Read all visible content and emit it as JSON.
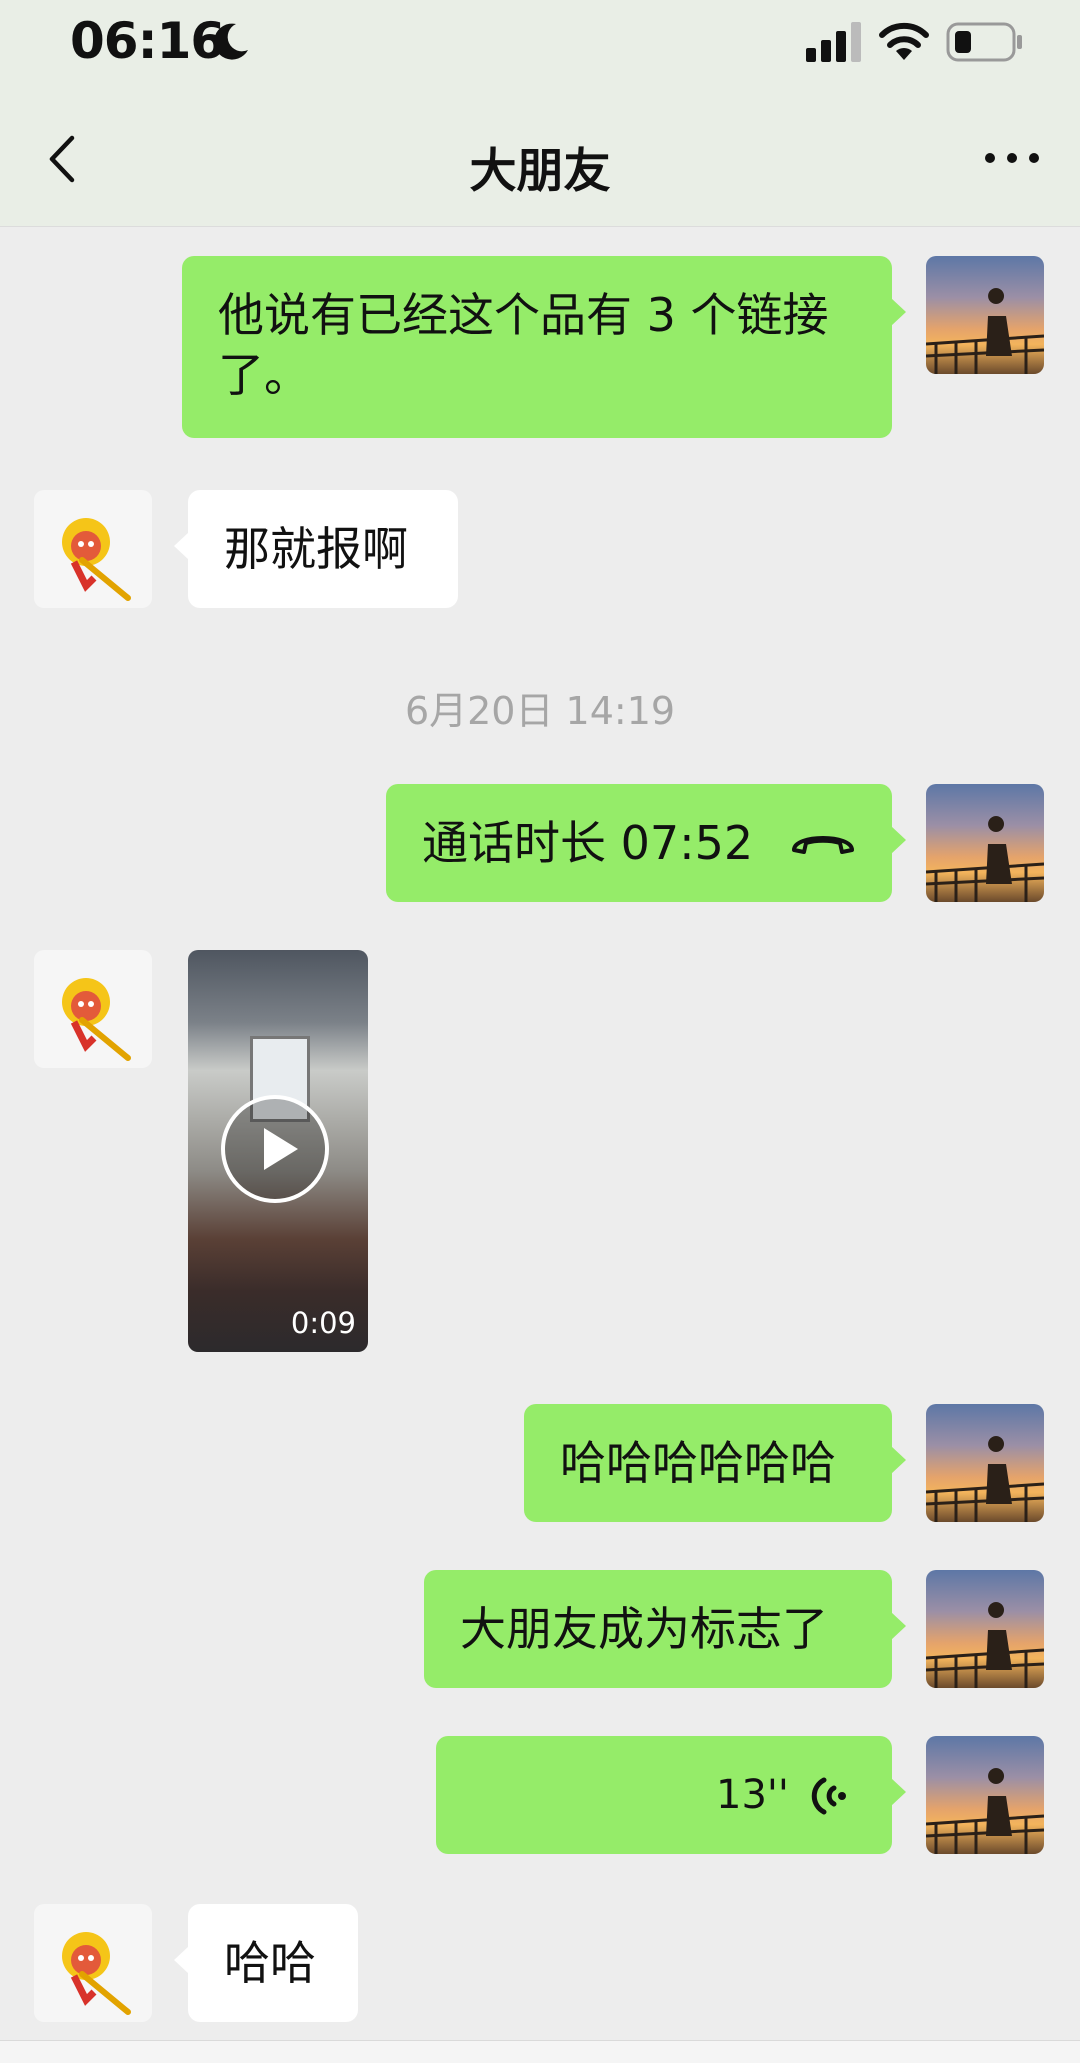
{
  "status_bar": {
    "time": "06:16"
  },
  "nav": {
    "title": "大朋友"
  },
  "messages": [
    {
      "text": "他说有已经这个品有 3 个链接了。"
    },
    {
      "text": "那就报啊"
    },
    {
      "text": "通话时长 07:52"
    },
    {
      "duration": "0:09"
    },
    {
      "text": "哈哈哈哈哈哈"
    },
    {
      "text": "大朋友成为标志了"
    },
    {
      "text": "13''"
    },
    {
      "text": "哈哈"
    }
  ],
  "timestamp": "6月20日 14:19",
  "colors": {
    "outgoing_bubble": "#95ec69",
    "incoming_bubble": "#ffffff",
    "background": "#ededed",
    "header": "#e9eee6"
  },
  "icons": [
    "moon-icon",
    "signal-icon",
    "wifi-icon",
    "battery-icon",
    "back-icon",
    "more-icon",
    "phone-hangup-icon",
    "play-icon",
    "voice-icon"
  ]
}
